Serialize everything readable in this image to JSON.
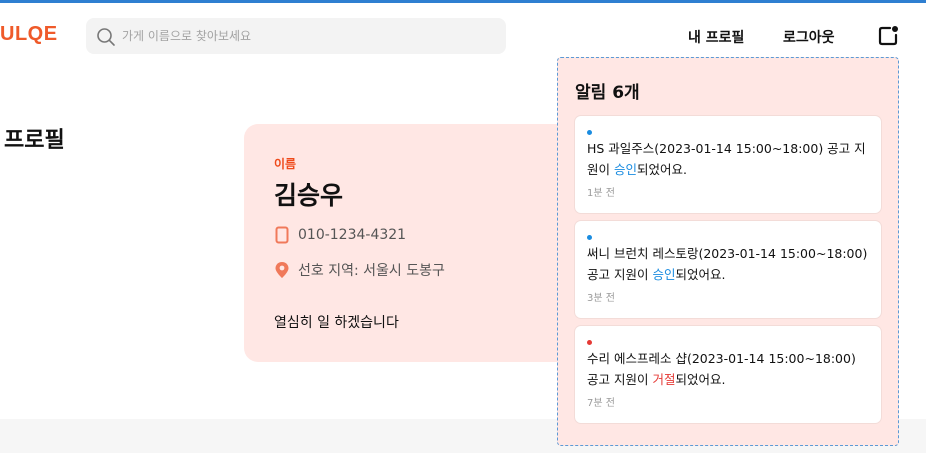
{
  "header": {
    "logo": "ULQE",
    "search": {
      "placeholder": "가게 이름으로 찾아보세요",
      "value": ""
    },
    "nav": {
      "profile": "내 프로필",
      "logout": "로그아웃"
    }
  },
  "page": {
    "title": "프로필"
  },
  "profile": {
    "name_label": "이름",
    "name": "김승우",
    "phone": "010-1234-4321",
    "region": "선호 지역: 서울시 도봉구",
    "intro": "열심히 일 하겠습니다"
  },
  "notifications": {
    "title": "알림 6개",
    "items": [
      {
        "status": "approved",
        "dot_color": "#1a8ce0",
        "prefix": "HS 과일주스(2023-01-14 15:00~18:00) 공고 지원이 ",
        "status_word": "승인",
        "suffix": "되었어요.",
        "time": "1분 전"
      },
      {
        "status": "approved",
        "dot_color": "#1a8ce0",
        "prefix": "써니 브런치 레스토랑(2023-01-14 15:00~18:00) 공고 지원이 ",
        "status_word": "승인",
        "suffix": "되었어요.",
        "time": "3분 전"
      },
      {
        "status": "rejected",
        "dot_color": "#e53935",
        "prefix": "수리 에스프레소 샵(2023-01-14 15:00~18:00) 공고 지원이 ",
        "status_word": "거절",
        "suffix": "되었어요.",
        "time": "7분 전"
      }
    ]
  },
  "colors": {
    "accent": "#ef5a2a",
    "card_bg": "#ffe7e4",
    "approved": "#1a8ce0",
    "rejected": "#e53935"
  },
  "icons": {
    "search": "search-icon",
    "bell": "notification-icon",
    "phone": "phone-icon",
    "location": "location-pin-icon"
  }
}
